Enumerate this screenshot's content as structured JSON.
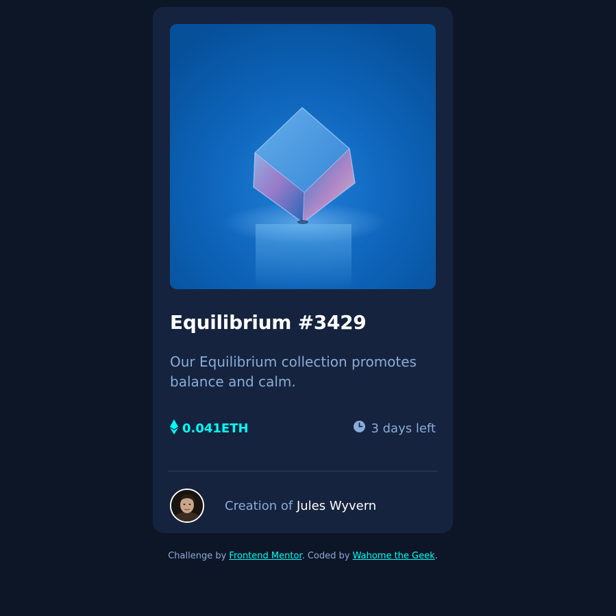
{
  "card": {
    "title": "Equilibrium #3429",
    "description": "Our Equilibrium collection promotes balance and calm.",
    "price": "0.041ETH",
    "time_left": "3 days left",
    "creator_prefix": "Creation of ",
    "creator_name": "Jules Wyvern"
  },
  "footer": {
    "prefix": "Challenge by ",
    "challenge_link": "Frontend Mentor",
    "middle": ". Coded by ",
    "author_link": "Wahome the Geek",
    "suffix": "."
  },
  "icons": {
    "price": "ethereum-icon",
    "time": "clock-icon"
  },
  "colors": {
    "page_bg": "#0d1627",
    "card_bg": "#15233e",
    "accent_cyan": "#00fff7",
    "soft_blue": "#8bacd9",
    "white": "#ffffff",
    "divider": "#2e405a"
  }
}
